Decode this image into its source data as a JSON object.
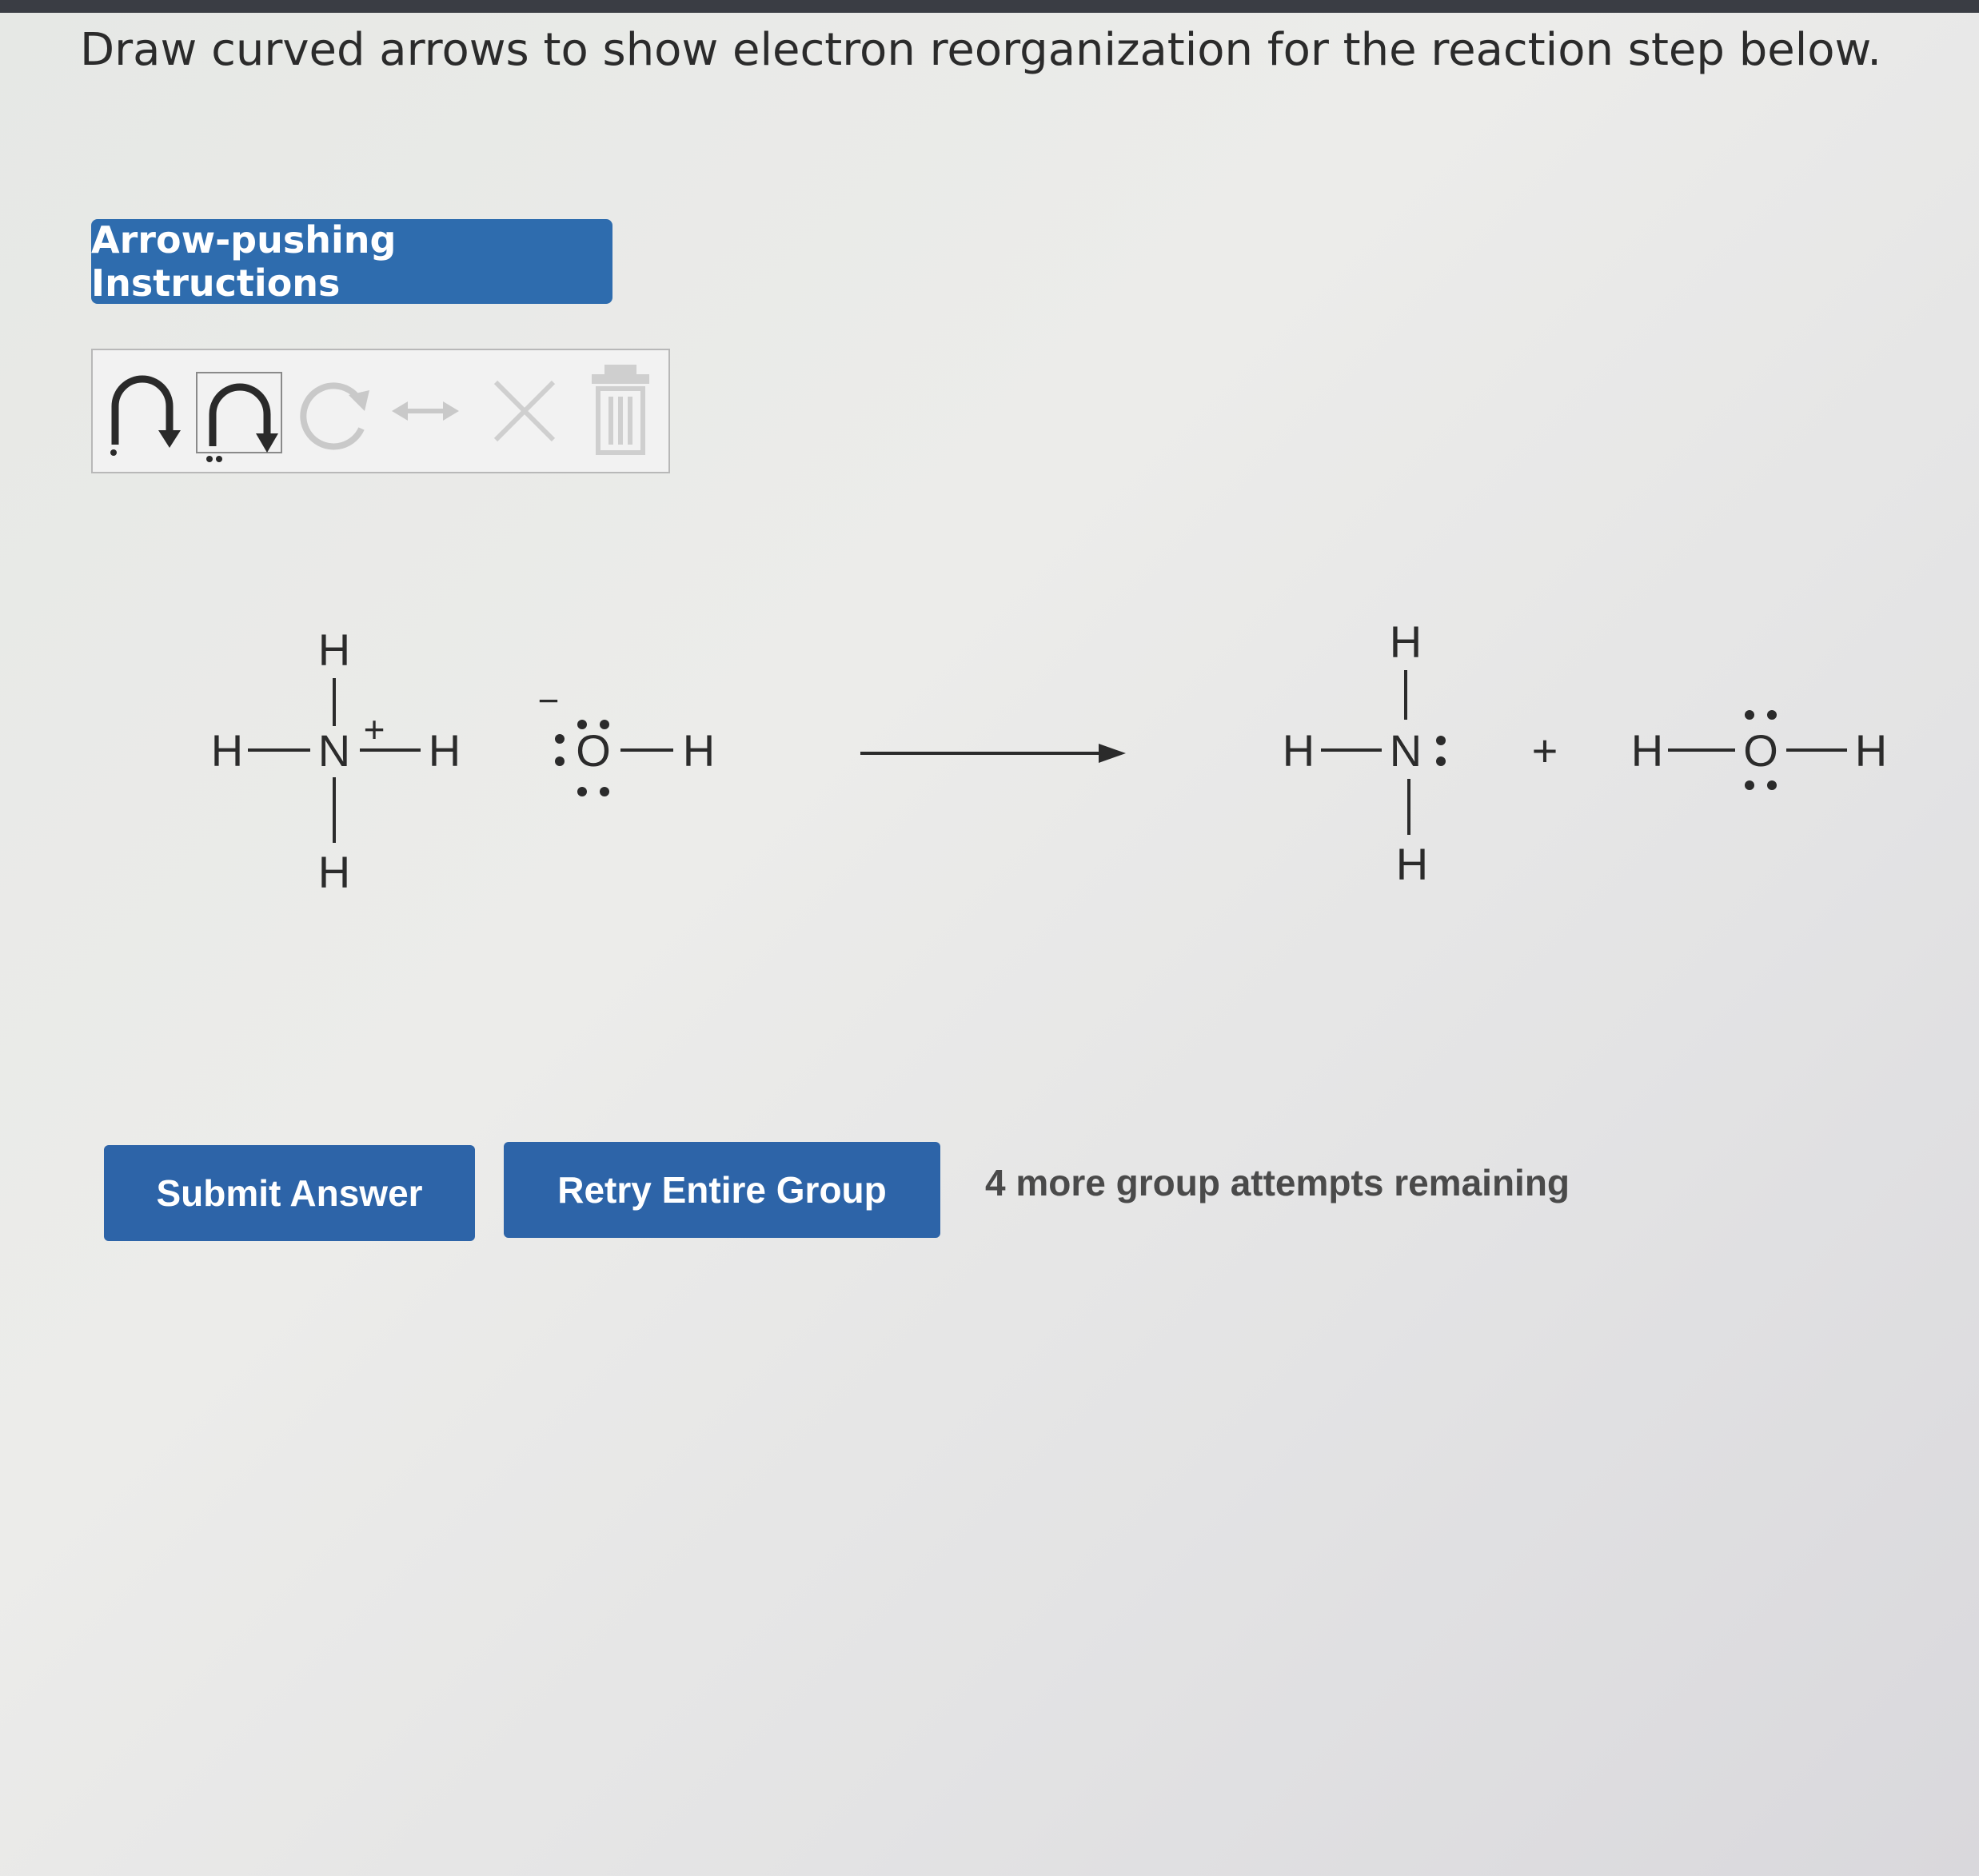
{
  "question": {
    "title": "Draw curved arrows to show electron reorganization for the reaction step below."
  },
  "instructions_button": {
    "label": "Arrow-pushing Instructions"
  },
  "toolbar": {
    "tools": [
      "curved-arrow-icon",
      "lone-pair-curved-arrow-icon",
      "rotate-icon",
      "resonance-arrow-icon",
      "delete-x-icon",
      "trash-icon"
    ]
  },
  "reaction": {
    "reactant1": {
      "center": "N",
      "substituent": "H",
      "charge": "+"
    },
    "reactant2": {
      "center": "O",
      "substituent": "H",
      "charge": "−"
    },
    "product1": {
      "center": "N",
      "substituent": "H"
    },
    "plus": "+",
    "product2": {
      "center": "O",
      "substituent": "H"
    }
  },
  "actions": {
    "submit_label": "Submit Answer",
    "retry_label": "Retry Entire Group",
    "attempts_text": "4 more group attempts remaining"
  },
  "colors": {
    "button_blue": "#2d64a8",
    "instructions_blue": "#2e6cae",
    "text": "#2b2b2b"
  }
}
